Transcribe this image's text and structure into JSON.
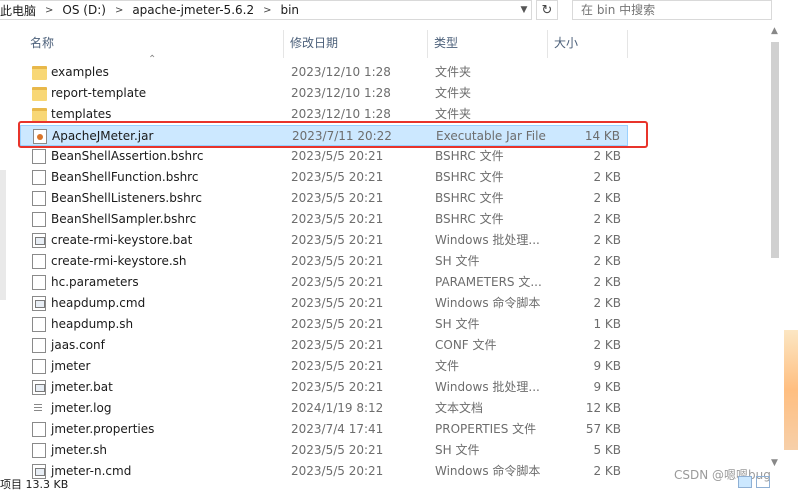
{
  "address": {
    "crumbs": [
      "此电脑",
      "OS (D:)",
      "apache-jmeter-5.6.2",
      "bin"
    ],
    "search_placeholder": "在 bin 中搜索"
  },
  "columns": {
    "name": "名称",
    "date": "修改日期",
    "type": "类型",
    "size": "大小"
  },
  "files": [
    {
      "name": "examples",
      "date": "2023/12/10 1:28",
      "type": "文件夹",
      "size": "",
      "icon": "folder"
    },
    {
      "name": "report-template",
      "date": "2023/12/10 1:28",
      "type": "文件夹",
      "size": "",
      "icon": "folder"
    },
    {
      "name": "templates",
      "date": "2023/12/10 1:28",
      "type": "文件夹",
      "size": "",
      "icon": "folder"
    },
    {
      "name": "ApacheJMeter.jar",
      "date": "2023/7/11 20:22",
      "type": "Executable Jar File",
      "size": "14 KB",
      "icon": "jar",
      "selected": true
    },
    {
      "name": "BeanShellAssertion.bshrc",
      "date": "2023/5/5 20:21",
      "type": "BSHRC 文件",
      "size": "2 KB",
      "icon": "doc"
    },
    {
      "name": "BeanShellFunction.bshrc",
      "date": "2023/5/5 20:21",
      "type": "BSHRC 文件",
      "size": "2 KB",
      "icon": "doc"
    },
    {
      "name": "BeanShellListeners.bshrc",
      "date": "2023/5/5 20:21",
      "type": "BSHRC 文件",
      "size": "2 KB",
      "icon": "doc"
    },
    {
      "name": "BeanShellSampler.bshrc",
      "date": "2023/5/5 20:21",
      "type": "BSHRC 文件",
      "size": "2 KB",
      "icon": "doc"
    },
    {
      "name": "create-rmi-keystore.bat",
      "date": "2023/5/5 20:21",
      "type": "Windows 批处理...",
      "size": "2 KB",
      "icon": "bat"
    },
    {
      "name": "create-rmi-keystore.sh",
      "date": "2023/5/5 20:21",
      "type": "SH 文件",
      "size": "2 KB",
      "icon": "doc"
    },
    {
      "name": "hc.parameters",
      "date": "2023/5/5 20:21",
      "type": "PARAMETERS 文...",
      "size": "2 KB",
      "icon": "doc"
    },
    {
      "name": "heapdump.cmd",
      "date": "2023/5/5 20:21",
      "type": "Windows 命令脚本",
      "size": "2 KB",
      "icon": "bat"
    },
    {
      "name": "heapdump.sh",
      "date": "2023/5/5 20:21",
      "type": "SH 文件",
      "size": "1 KB",
      "icon": "doc"
    },
    {
      "name": "jaas.conf",
      "date": "2023/5/5 20:21",
      "type": "CONF 文件",
      "size": "2 KB",
      "icon": "doc"
    },
    {
      "name": "jmeter",
      "date": "2023/5/5 20:21",
      "type": "文件",
      "size": "9 KB",
      "icon": "doc"
    },
    {
      "name": "jmeter.bat",
      "date": "2023/5/5 20:21",
      "type": "Windows 批处理...",
      "size": "9 KB",
      "icon": "bat"
    },
    {
      "name": "jmeter.log",
      "date": "2024/1/19 8:12",
      "type": "文本文档",
      "size": "12 KB",
      "icon": "log"
    },
    {
      "name": "jmeter.properties",
      "date": "2023/7/4 17:41",
      "type": "PROPERTIES 文件",
      "size": "57 KB",
      "icon": "doc"
    },
    {
      "name": "jmeter.sh",
      "date": "2023/5/5 20:21",
      "type": "SH 文件",
      "size": "5 KB",
      "icon": "doc"
    },
    {
      "name": "jmeter-n.cmd",
      "date": "2023/5/5 20:21",
      "type": "Windows 命令脚本",
      "size": "2 KB",
      "icon": "bat"
    }
  ],
  "status": {
    "text": "项目 13.3 KB"
  },
  "watermark": "CSDN @嗯嗯bug",
  "colors": {
    "selection": "#cce8ff",
    "highlight_box": "#e8342b"
  }
}
